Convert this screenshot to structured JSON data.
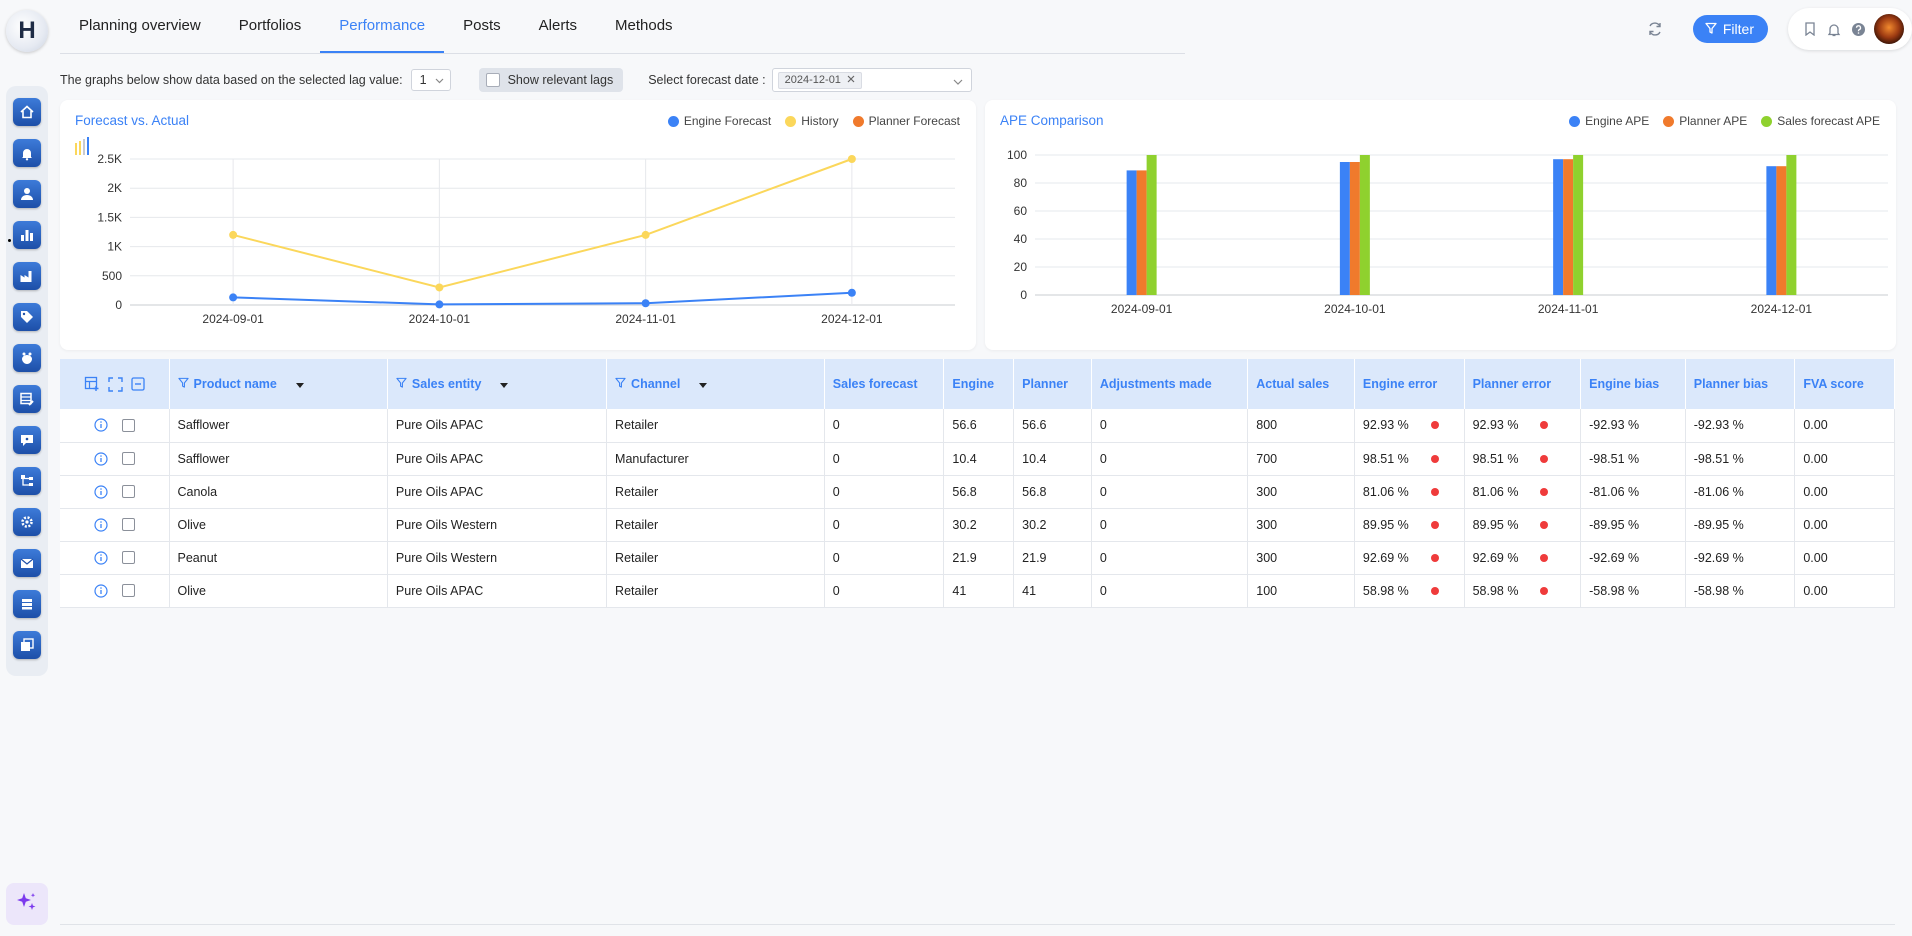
{
  "logo_letter": "H",
  "nav": {
    "tabs": [
      {
        "label": "Planning overview"
      },
      {
        "label": "Portfolios"
      },
      {
        "label": "Performance"
      },
      {
        "label": "Posts"
      },
      {
        "label": "Alerts"
      },
      {
        "label": "Methods"
      }
    ],
    "active": "Performance",
    "filter_label": "Filter"
  },
  "sidebar": {
    "icons": [
      "home-icon",
      "alert-bell-icon",
      "user-upload-icon",
      "performance-chart-icon",
      "factory-icon",
      "tag-icon",
      "hand-icon",
      "edit-table-icon",
      "chat-icon",
      "hierarchy-icon",
      "settings-icon",
      "mail-icon",
      "stack-icon",
      "layers-icon"
    ],
    "active_index": 3,
    "ai_icon": "sparkle-icon"
  },
  "controls": {
    "lag_text": "The graphs below show data based on the selected lag value:",
    "lag_value": "1",
    "show_lags_label": "Show relevant lags",
    "forecast_date_label": "Select forecast date :",
    "forecast_date_tag": "2024-12-01"
  },
  "chart_data": [
    {
      "type": "line",
      "title": "Forecast vs. Actual",
      "x": [
        "2024-09-01",
        "2024-10-01",
        "2024-11-01",
        "2024-12-01"
      ],
      "y_ticks": [
        "0",
        "500",
        "1K",
        "1.5K",
        "2K",
        "2.5K"
      ],
      "ylim": [
        0,
        2500
      ],
      "legend": "top-right",
      "series": [
        {
          "name": "Engine Forecast",
          "color": "#3b82f6",
          "values": [
            130,
            10,
            30,
            210
          ]
        },
        {
          "name": "History",
          "color": "#fbd75b",
          "values": [
            1200,
            300,
            1200,
            2500
          ]
        },
        {
          "name": "Planner Forecast",
          "color": "#f07a2c",
          "values": [
            null,
            null,
            null,
            null
          ]
        }
      ]
    },
    {
      "type": "bar",
      "title": "APE Comparison",
      "categories": [
        "2024-09-01",
        "2024-10-01",
        "2024-11-01",
        "2024-12-01"
      ],
      "y_ticks": [
        "0",
        "20",
        "40",
        "60",
        "80",
        "100"
      ],
      "ylim": [
        0,
        100
      ],
      "legend": "top-right",
      "series": [
        {
          "name": "Engine APE",
          "color": "#3b82f6",
          "values": [
            89,
            95,
            97,
            92
          ]
        },
        {
          "name": "Planner APE",
          "color": "#f07a2c",
          "values": [
            89,
            95,
            97,
            92
          ]
        },
        {
          "name": "Sales forecast APE",
          "color": "#8fd12e",
          "values": [
            100,
            100,
            100,
            100
          ]
        }
      ]
    }
  ],
  "table": {
    "columns": [
      "Product name",
      "Sales entity",
      "Channel",
      "Sales forecast",
      "Engine",
      "Planner",
      "Adjustments made",
      "Actual sales",
      "Engine error",
      "Planner error",
      "Engine bias",
      "Planner bias",
      "FVA score"
    ],
    "rows": [
      {
        "product": "Safflower",
        "entity": "Pure Oils APAC",
        "channel": "Retailer",
        "sales_forecast": "0",
        "engine": "56.6",
        "planner": "56.6",
        "adjustments": "0",
        "actual": "800",
        "engine_error": "92.93 %",
        "planner_error": "92.93 %",
        "engine_bias": "-92.93 %",
        "planner_bias": "-92.93 %",
        "fva": "0.00"
      },
      {
        "product": "Safflower",
        "entity": "Pure Oils APAC",
        "channel": "Manufacturer",
        "sales_forecast": "0",
        "engine": "10.4",
        "planner": "10.4",
        "adjustments": "0",
        "actual": "700",
        "engine_error": "98.51 %",
        "planner_error": "98.51 %",
        "engine_bias": "-98.51 %",
        "planner_bias": "-98.51 %",
        "fva": "0.00"
      },
      {
        "product": "Canola",
        "entity": "Pure Oils APAC",
        "channel": "Retailer",
        "sales_forecast": "0",
        "engine": "56.8",
        "planner": "56.8",
        "adjustments": "0",
        "actual": "300",
        "engine_error": "81.06 %",
        "planner_error": "81.06 %",
        "engine_bias": "-81.06 %",
        "planner_bias": "-81.06 %",
        "fva": "0.00"
      },
      {
        "product": "Olive",
        "entity": "Pure Oils Western",
        "channel": "Retailer",
        "sales_forecast": "0",
        "engine": "30.2",
        "planner": "30.2",
        "adjustments": "0",
        "actual": "300",
        "engine_error": "89.95 %",
        "planner_error": "89.95 %",
        "engine_bias": "-89.95 %",
        "planner_bias": "-89.95 %",
        "fva": "0.00"
      },
      {
        "product": "Peanut",
        "entity": "Pure Oils Western",
        "channel": "Retailer",
        "sales_forecast": "0",
        "engine": "21.9",
        "planner": "21.9",
        "adjustments": "0",
        "actual": "300",
        "engine_error": "92.69 %",
        "planner_error": "92.69 %",
        "engine_bias": "-92.69 %",
        "planner_bias": "-92.69 %",
        "fva": "0.00"
      },
      {
        "product": "Olive",
        "entity": "Pure Oils APAC",
        "channel": "Retailer",
        "sales_forecast": "0",
        "engine": "41",
        "planner": "41",
        "adjustments": "0",
        "actual": "100",
        "engine_error": "58.98 %",
        "planner_error": "58.98 %",
        "engine_bias": "-58.98 %",
        "planner_bias": "-58.98 %",
        "fva": "0.00"
      }
    ]
  },
  "colors": {
    "accent": "#3b82f6",
    "error_dot": "#ef3b3b",
    "header_bg": "#dbe8fb"
  }
}
